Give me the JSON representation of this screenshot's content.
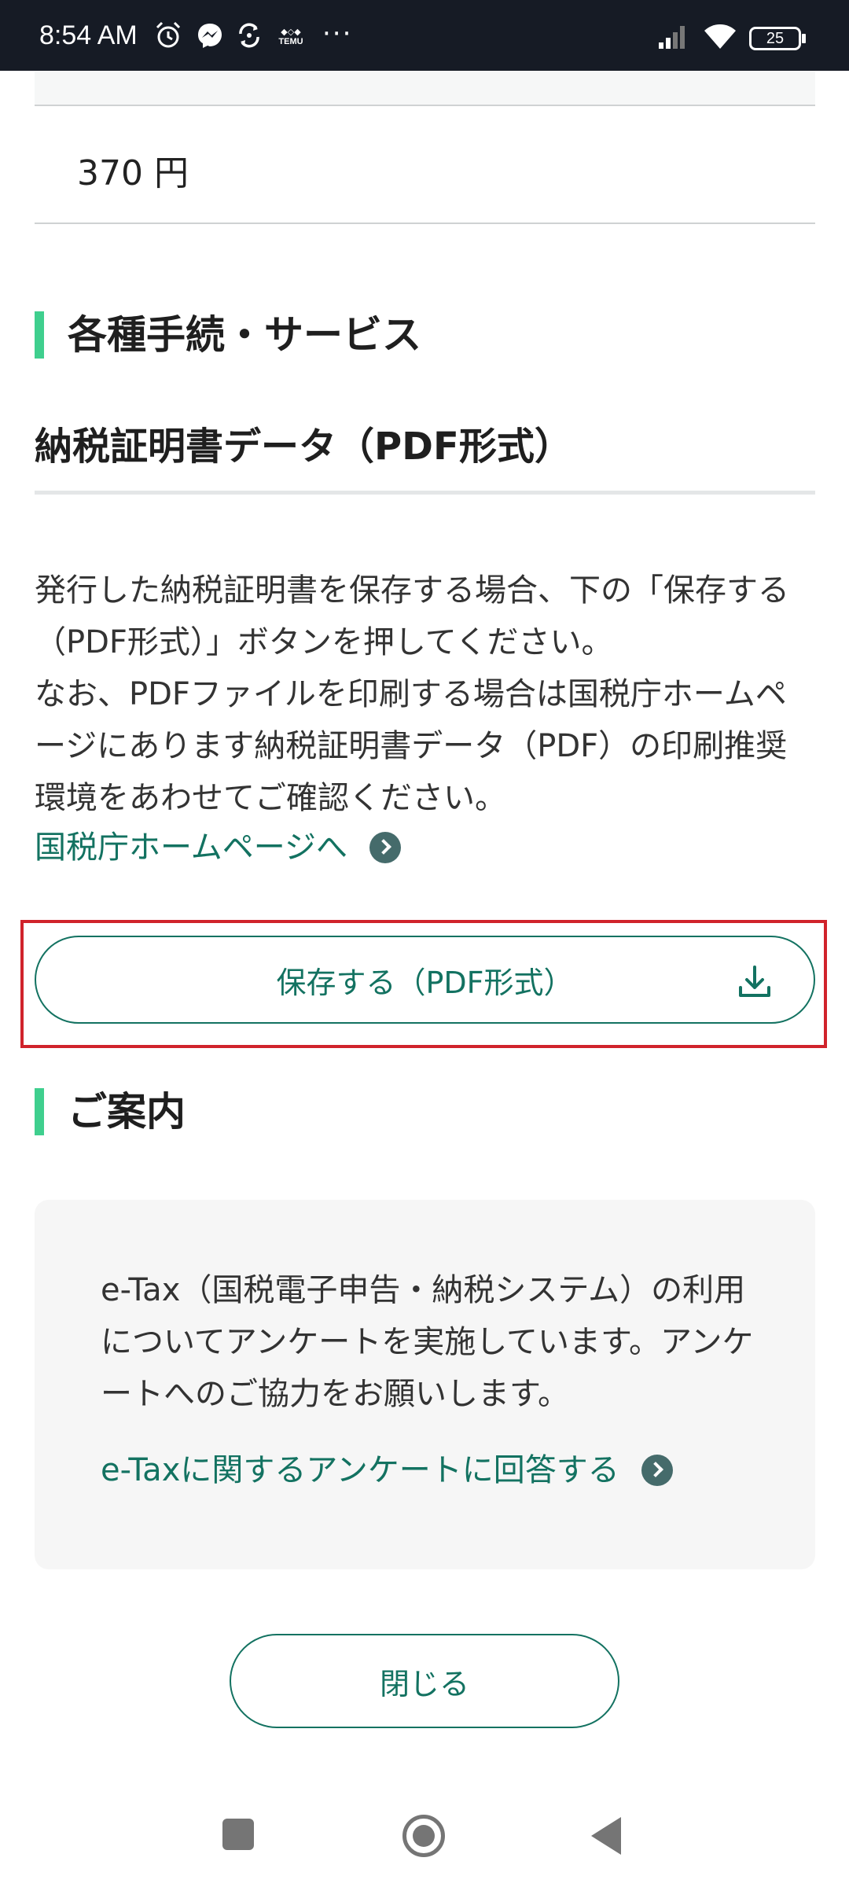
{
  "status_bar": {
    "time": "8:54 AM",
    "icons": [
      "alarm-icon",
      "messenger-icon",
      "sync-icon",
      "temu-icon"
    ],
    "more": "···",
    "battery": "25"
  },
  "fee": {
    "amount": "370 円"
  },
  "procedures": {
    "heading": "各種手続・サービス",
    "subheading": "納税証明書データ（PDF形式）",
    "description_lines": [
      "発行した納税証明書を保存する場合、下の「保存する",
      "（PDF形式）」ボタンを押してください。",
      "なお、PDFファイルを印刷する場合は国税庁ホームペ",
      "ージにあります納税証明書データ（PDF）の印刷推奨",
      "環境をあわせてご確認ください。"
    ],
    "link": "国税庁ホームページへ",
    "save_button": "保存する（PDF形式）"
  },
  "guide": {
    "heading": "ご案内",
    "text_lines": [
      "e-Tax（国税電子申告・納税システム）の利用",
      "についてアンケートを実施しています。アンケ",
      "ートへのご協力をお願いします。"
    ],
    "link": "e-Taxに関するアンケートに回答する"
  },
  "close_button": "閉じる",
  "colors": {
    "accent": "#137261",
    "heading_bar": "#3fcf8e",
    "highlight": "#d0232b",
    "status_bar": "#161b25"
  }
}
